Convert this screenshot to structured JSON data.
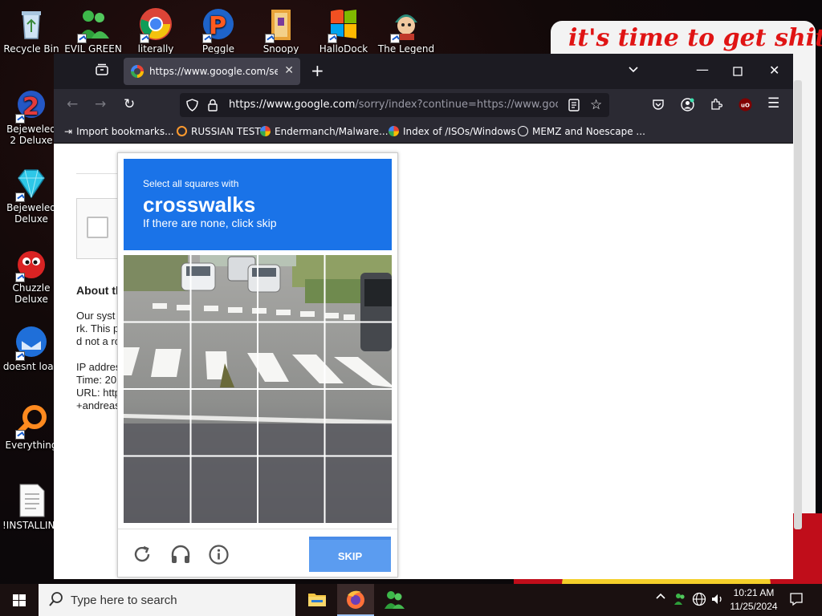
{
  "desktop": {
    "background_text": "it's time to get shit",
    "icons": [
      {
        "label": "Recycle Bin"
      },
      {
        "label": "EVIL GREEN"
      },
      {
        "label": "literally"
      },
      {
        "label": "Peggle Nights"
      },
      {
        "label": "Snoopy"
      },
      {
        "label": "HalloDock"
      },
      {
        "label": "The Legend"
      },
      {
        "label": "Bejeweled 2 Deluxe"
      },
      {
        "label": "Bejeweled Deluxe"
      },
      {
        "label": "Chuzzle Deluxe"
      },
      {
        "label": "doesnt load"
      },
      {
        "label": "Everything"
      },
      {
        "label": "!INSTALLIN..."
      }
    ]
  },
  "browser": {
    "tab_title": "https://www.google.com/search",
    "url_host": "https://www.google.com",
    "url_path": "/sorry/index?continue=https://www.google",
    "bookmarks": [
      {
        "label": "Import bookmarks..."
      },
      {
        "label": "RUSSIAN TEST"
      },
      {
        "label": "Endermanch/Malware..."
      },
      {
        "label": "Index of /ISOs/Windows"
      },
      {
        "label": "MEMZ and Noescape ..."
      }
    ],
    "page": {
      "heading_fragment": "About th",
      "lines": [
        "Our syst",
        "rk. This p",
        "d not a ro",
        "IP addres",
        "Time: 20",
        "URL: http",
        "+andreas"
      ]
    }
  },
  "captcha": {
    "instruction": "Select all squares with",
    "target": "crosswalks",
    "hint": "If there are none, click skip",
    "skip_label": "SKIP"
  },
  "taskbar": {
    "search_placeholder": "Type here to search",
    "time": "10:21 AM",
    "date": "11/25/2024"
  }
}
